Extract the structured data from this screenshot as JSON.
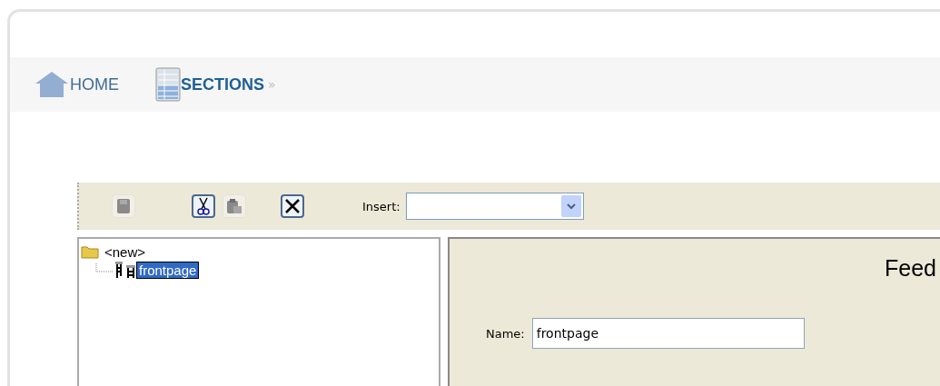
{
  "breadcrumb": [
    {
      "label": "HOME",
      "kind": "home",
      "current": false
    },
    {
      "label": "SECTIONS",
      "kind": "sections",
      "current": true
    }
  ],
  "breadcrumb_separator": "»",
  "toolbar": {
    "buttons": [
      {
        "kind": "save",
        "disabled": true
      },
      {
        "kind": "cut",
        "disabled": false
      },
      {
        "kind": "paste",
        "disabled": true
      },
      {
        "kind": "delete",
        "disabled": false
      }
    ],
    "insert_label": "Insert:"
  },
  "tree": [
    {
      "label": "<new>",
      "selected": false,
      "children": [
        {
          "label": "frontpage",
          "selected": true
        }
      ]
    }
  ],
  "detail": {
    "title": "Feed",
    "name_label": "Name:",
    "name_value": "frontpage"
  }
}
